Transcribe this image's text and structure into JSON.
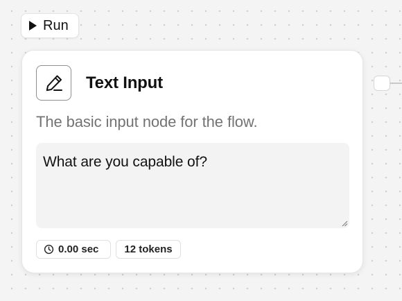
{
  "toolbar": {
    "run_label": "Run",
    "run_icon": "play-icon"
  },
  "node": {
    "icon": "pencil-icon",
    "title": "Text Input",
    "description": "The basic input node for the flow.",
    "input_value": "What are you capable of?",
    "stats": {
      "duration": "0.00 sec",
      "duration_icon": "clock-icon",
      "tokens": "12 tokens"
    }
  },
  "colors": {
    "canvas_background": "#f4f4f4",
    "card_background": "#ffffff",
    "description_text": "#737373",
    "input_background": "#f3f3f3"
  }
}
